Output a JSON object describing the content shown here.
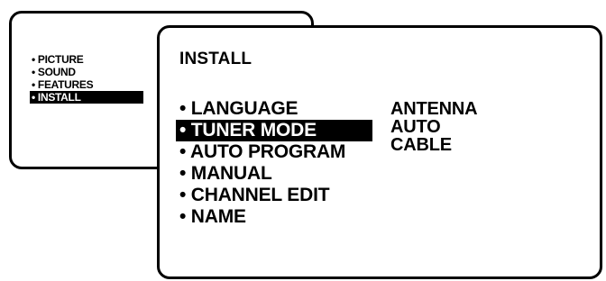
{
  "main_menu": {
    "items": [
      {
        "label": "• PICTURE",
        "selected": false
      },
      {
        "label": "• SOUND",
        "selected": false
      },
      {
        "label": "• FEATURES",
        "selected": false
      },
      {
        "label": "• INSTALL",
        "selected": true
      }
    ]
  },
  "install_menu": {
    "title": "INSTALL",
    "items": [
      {
        "label": "• LANGUAGE",
        "selected": false
      },
      {
        "label": "• TUNER MODE",
        "selected": true
      },
      {
        "label": "• AUTO PROGRAM",
        "selected": false
      },
      {
        "label": "• MANUAL",
        "selected": false
      },
      {
        "label": "• CHANNEL EDIT",
        "selected": false
      },
      {
        "label": "• NAME",
        "selected": false
      }
    ],
    "tuner_mode_options": [
      "ANTENNA",
      "AUTO",
      "CABLE"
    ]
  },
  "colors": {
    "foreground": "#000000",
    "background": "#ffffff",
    "highlight_bg": "#000000",
    "highlight_fg": "#ffffff"
  }
}
